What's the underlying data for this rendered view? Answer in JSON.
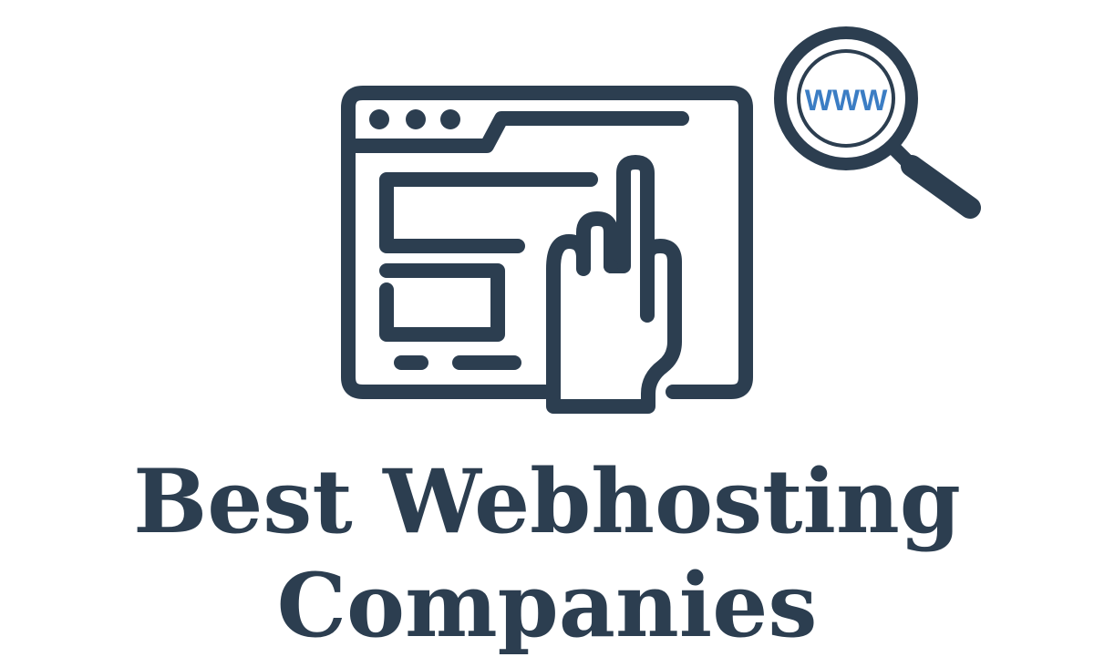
{
  "colors": {
    "ink": "#2c3e50",
    "accent": "#3b7dc4",
    "background": "#ffffff"
  },
  "icons": {
    "browser": "browser-window-icon",
    "hand": "pointing-hand-icon",
    "magnifier": "magnifying-glass-icon"
  },
  "magnifier": {
    "label": "WWW"
  },
  "title": {
    "line1": "Best Webhosting",
    "line2": "Companies"
  }
}
